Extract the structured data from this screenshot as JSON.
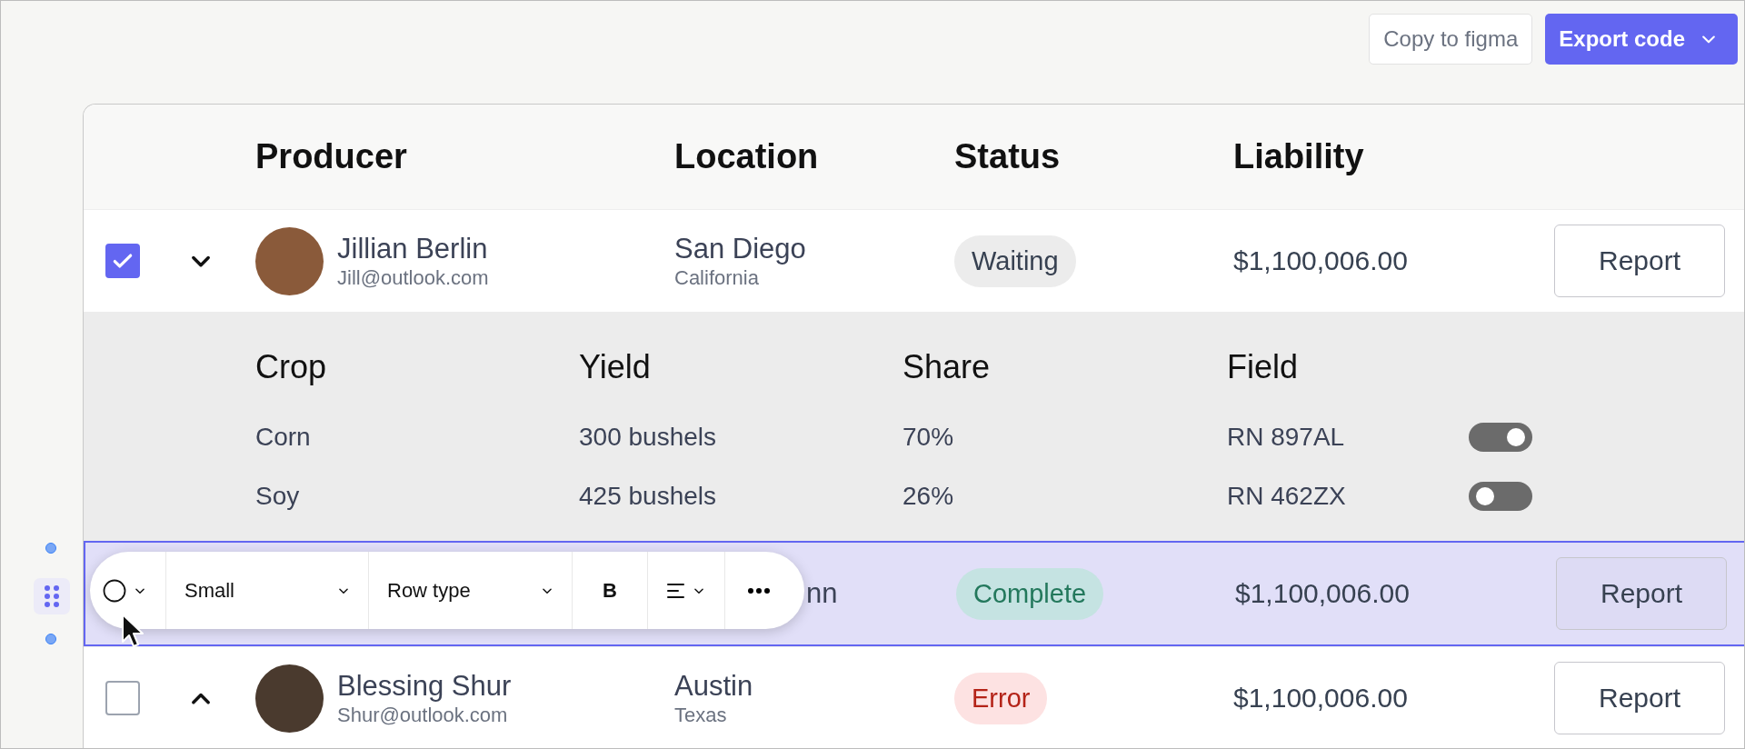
{
  "toolbar_actions": [
    {
      "label": "Copy to figma",
      "kind": "secondary"
    },
    {
      "label": "Export code",
      "kind": "primary"
    }
  ],
  "table": {
    "columns": [
      "Producer",
      "Location",
      "Status",
      "Liability"
    ],
    "rows": [
      {
        "selected": false,
        "checked": true,
        "expanded": true,
        "name": "Jillian Berlin",
        "email": "Jill@outlook.com",
        "city": "San Diego",
        "state": "California",
        "status": {
          "label": "Waiting",
          "kind": "neutral"
        },
        "amount": "$1,100,006.00",
        "action": "Report",
        "details": {
          "columns": [
            "Crop",
            "Yield",
            "Share",
            "Field"
          ],
          "rows": [
            {
              "crop": "Corn",
              "yield": "300 bushels",
              "share": "70%",
              "field": "RN 897AL",
              "on": true
            },
            {
              "crop": "Soy",
              "yield": "425 bushels",
              "share": "26%",
              "field": "RN 462ZX",
              "on": false
            }
          ]
        }
      },
      {
        "selected": true,
        "name": "nn",
        "status": {
          "label": "Complete",
          "kind": "success"
        },
        "amount": "$1,100,006.00",
        "action": "Report"
      },
      {
        "selected": false,
        "checked": false,
        "expanded": false,
        "name": "Blessing Shur",
        "email": "Shur@outlook.com",
        "city": "Austin",
        "state": "Texas",
        "status": {
          "label": "Error",
          "kind": "error"
        },
        "amount": "$1,100,006.00",
        "action": "Report"
      }
    ]
  },
  "row_toolbar": {
    "size": "Small",
    "row_type": "Row type",
    "bold": "B"
  }
}
